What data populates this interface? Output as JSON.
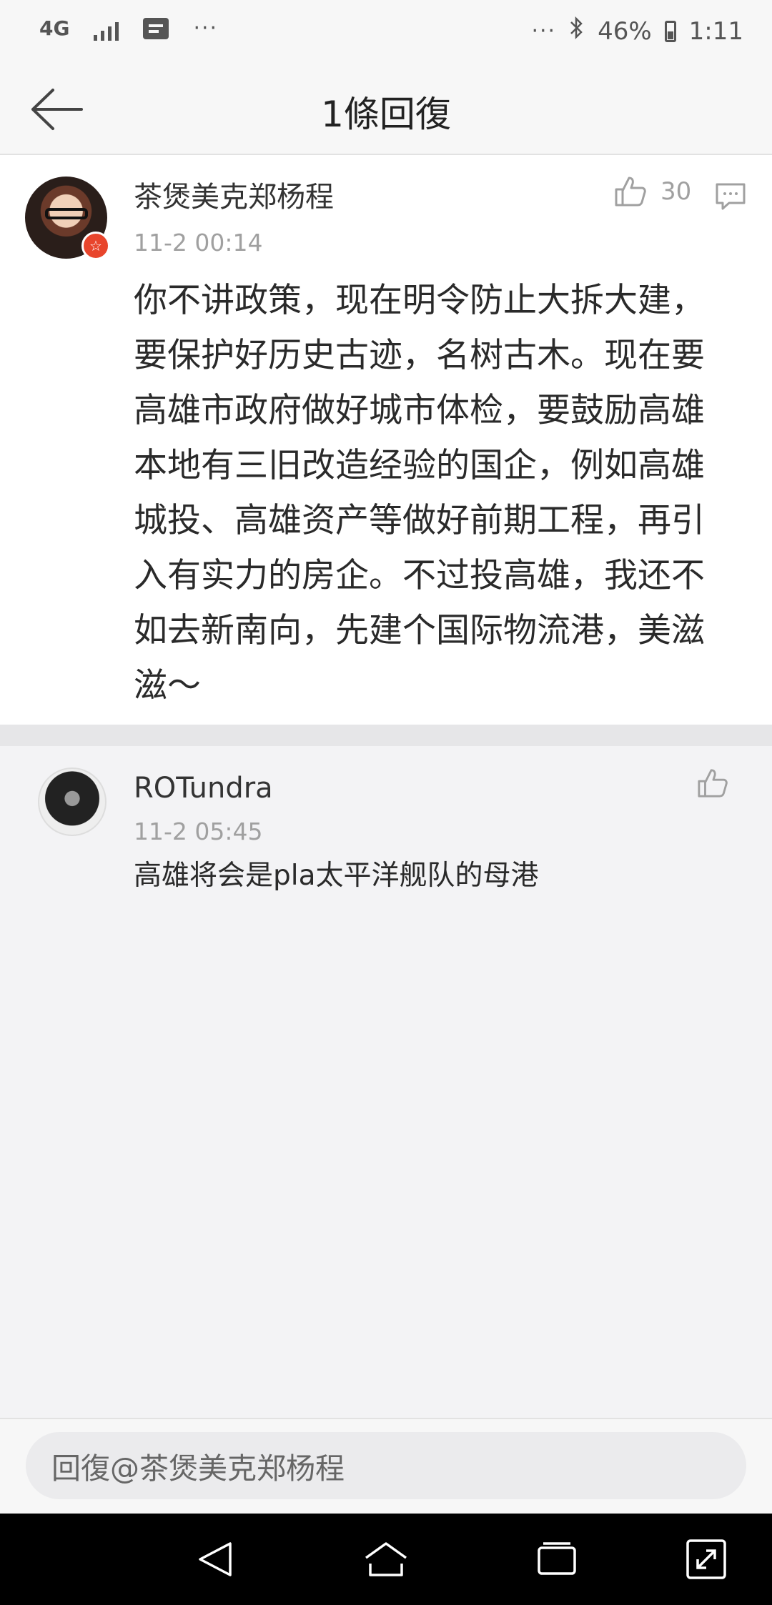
{
  "status_bar": {
    "network": "4G",
    "dots_left": "···",
    "dots_right": "···",
    "battery": "46%",
    "time": "1:11",
    "icons": [
      "network-4g-icon",
      "signal-icon",
      "message-icon",
      "bluetooth-icon",
      "battery-icon"
    ]
  },
  "header": {
    "title": "1條回復",
    "back_icon": "back-arrow-icon"
  },
  "comments": [
    {
      "author": "茶煲美克郑杨程",
      "time": "11-2 00:14",
      "likes": "30",
      "text": "你不讲政策，现在明令防止大拆大建，要保护好历史古迹，名树古木。现在要高雄市政府做好城市体检，要鼓励高雄本地有三旧改造经验的国企，例如高雄城投、高雄资产等做好前期工程，再引入有实力的房企。不过投高雄，我还不如去新南向，先建个国际物流港，美滋滋～",
      "badge": "☆"
    },
    {
      "author": "ROTundra",
      "time": "11-2 05:45",
      "text": "高雄将会是pla太平洋舰队的母港"
    }
  ],
  "reply": {
    "placeholder": "回復@茶煲美克郑杨程"
  },
  "nav": {
    "icons": [
      "back-triangle-icon",
      "home-icon",
      "recents-icon",
      "expand-icon"
    ]
  },
  "colors": {
    "background": "#f3f3f5",
    "card": "#ffffff",
    "badge": "#e8452c",
    "secondary_text": "#a0a0a0"
  }
}
